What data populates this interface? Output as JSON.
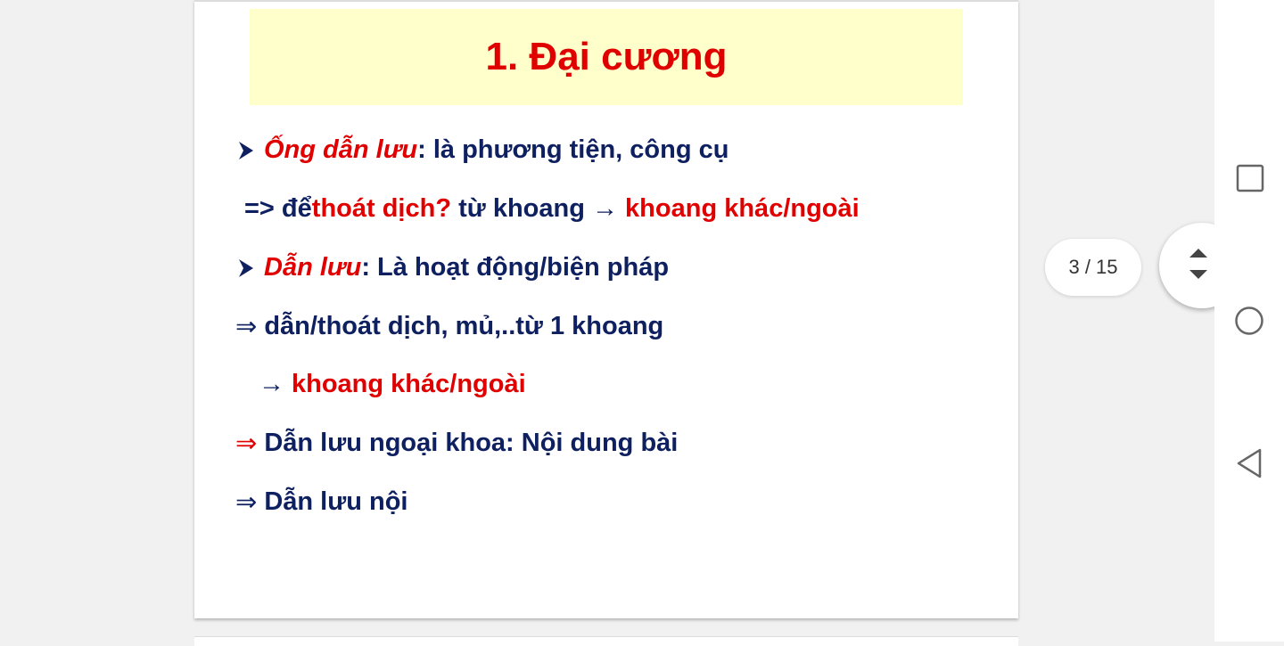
{
  "slide": {
    "title": "1. Đại cương",
    "lines": [
      {
        "a": "Ống dẫn lưu",
        "b": ": là phương tiện, công cụ"
      },
      {
        "a": "=> để ",
        "b": "thoát dịch?",
        "c": " từ khoang → ",
        "d": "khoang khác/ngoài"
      },
      {
        "a": "Dẫn lưu",
        "b": ": Là hoạt động/biện pháp"
      },
      {
        "sym": "⇒",
        "a": "dẫn/thoát dịch, mủ,..từ 1 khoang"
      },
      {
        "sym": "→",
        "a": "khoang khác/ngoài"
      },
      {
        "sym": "⇒",
        "a": "Dẫn lưu ngoại khoa: Nội dung bài"
      },
      {
        "sym": "⇒",
        "a": "Dẫn lưu nội"
      }
    ]
  },
  "viewer": {
    "page_indicator": "3 / 15",
    "scroll_icon": "up-down-arrows-icon"
  },
  "navbar": {
    "icons": [
      "recent-apps-icon",
      "home-icon",
      "back-icon"
    ]
  },
  "colors": {
    "title_red": "#e00000",
    "text_navy": "#0f2060",
    "title_bg": "#ffffcc"
  }
}
